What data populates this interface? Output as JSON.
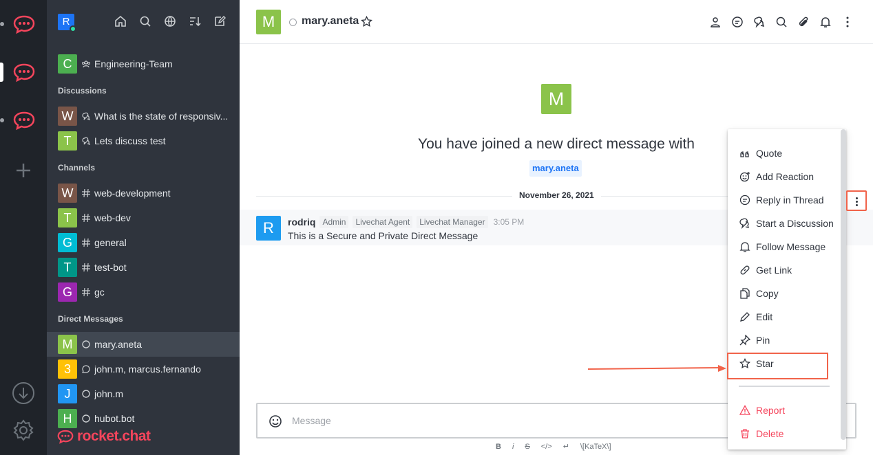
{
  "colors": {
    "rail_bg": "#1f2329",
    "sidebar_bg": "#2f343d",
    "accent": "#1d74f5",
    "danger": "#f5455c",
    "annotation": "#f1634a"
  },
  "user": {
    "avatar_letter": "R"
  },
  "sidebar": {
    "top_items": [
      {
        "avatar": "C",
        "color": "#4caf50",
        "icon": "team-icon",
        "label": "Engineering-Team"
      }
    ],
    "discussions_heading": "Discussions",
    "discussions": [
      {
        "avatar": "W",
        "color": "#795548",
        "icon": "discussion-icon",
        "label": "What is the state of responsiv..."
      },
      {
        "avatar": "T",
        "color": "#8bc34a",
        "icon": "discussion-icon",
        "label": "Lets discuss test"
      }
    ],
    "channels_heading": "Channels",
    "channels": [
      {
        "avatar": "W",
        "color": "#795548",
        "icon": "hash-icon",
        "label": "web-development"
      },
      {
        "avatar": "T",
        "color": "#8bc34a",
        "icon": "hash-icon",
        "label": "web-dev"
      },
      {
        "avatar": "G",
        "color": "#00bcd4",
        "icon": "hash-icon",
        "label": "general"
      },
      {
        "avatar": "T",
        "color": "#009688",
        "icon": "hash-icon",
        "label": "test-bot"
      },
      {
        "avatar": "G",
        "color": "#9c27b0",
        "icon": "hash-icon",
        "label": "gc"
      }
    ],
    "dm_heading": "Direct Messages",
    "direct_messages": [
      {
        "avatar": "M",
        "color": "#8bc34a",
        "icon": "status-offline-icon",
        "label": "mary.aneta",
        "selected": true
      },
      {
        "avatar": "3",
        "color": "#ffc107",
        "icon": "group-dm-icon",
        "label": "john.m, marcus.fernando"
      },
      {
        "avatar": "J",
        "color": "#2196f3",
        "icon": "status-offline-icon",
        "label": "john.m"
      },
      {
        "avatar": "H",
        "color": "#4caf50",
        "icon": "status-offline-icon",
        "label": "hubot.bot"
      }
    ],
    "brand": "rocket.chat"
  },
  "room": {
    "avatar": "M",
    "name": "mary.aneta"
  },
  "intro": {
    "avatar": "M",
    "text": "You have joined a new direct message with",
    "username": "mary.aneta"
  },
  "date_divider": "November 26, 2021",
  "message": {
    "avatar": "R",
    "user": "rodriq",
    "roles": [
      "Admin",
      "Livechat Agent",
      "Livechat Manager"
    ],
    "time": "3:05 PM",
    "text": "This is a Secure and Private Direct Message"
  },
  "composer": {
    "placeholder": "Message",
    "format_tools": [
      "B",
      "i",
      "S",
      "</>",
      "↵",
      "\\[KaTeX\\]"
    ]
  },
  "menu": {
    "items": [
      {
        "label": "Quote",
        "icon": "quote-icon"
      },
      {
        "label": "Add Reaction",
        "icon": "emoji-icon"
      },
      {
        "label": "Reply in Thread",
        "icon": "thread-icon"
      },
      {
        "label": "Start a Discussion",
        "icon": "discussion-icon"
      },
      {
        "label": "Follow Message",
        "icon": "bell-icon"
      },
      {
        "label": "Get Link",
        "icon": "link-icon"
      },
      {
        "label": "Copy",
        "icon": "copy-icon"
      },
      {
        "label": "Edit",
        "icon": "pencil-icon"
      },
      {
        "label": "Pin",
        "icon": "pin-icon"
      },
      {
        "label": "Star",
        "icon": "star-icon"
      }
    ],
    "danger_items": [
      {
        "label": "Report",
        "icon": "warning-icon"
      },
      {
        "label": "Delete",
        "icon": "trash-icon"
      }
    ]
  }
}
